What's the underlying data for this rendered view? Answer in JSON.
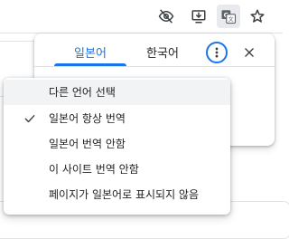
{
  "toolbar": {
    "icons": [
      "eye-off-icon",
      "install-app-icon",
      "translate-icon",
      "bookmark-star-icon"
    ]
  },
  "translate_bubble": {
    "tabs": [
      {
        "label": "일본어",
        "selected": true
      },
      {
        "label": "한국어",
        "selected": false
      }
    ],
    "options_icon": "more-vert-icon",
    "close_icon": "close-icon",
    "accent_color": "#1a73e8"
  },
  "options_menu": {
    "items": [
      {
        "label": "다른 언어 선택",
        "checked": false,
        "hovered": true
      },
      {
        "label": "일본어 항상 번역",
        "checked": true,
        "hovered": false
      },
      {
        "label": "일본어 번역 안함",
        "checked": false,
        "hovered": false
      },
      {
        "label": "이 사이트 번역 안함",
        "checked": false,
        "hovered": false
      },
      {
        "label": "페이지가 일본어로 표시되지 않음",
        "checked": false,
        "hovered": false
      }
    ]
  }
}
